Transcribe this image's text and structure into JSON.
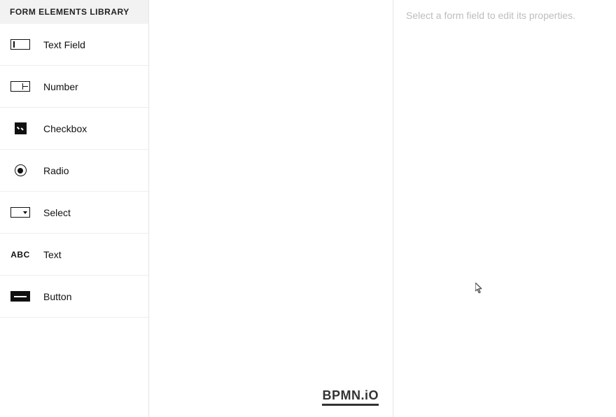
{
  "sidebar": {
    "header": "FORM ELEMENTS LIBRARY",
    "items": [
      {
        "label": "Text Field",
        "icon": "textfield-icon"
      },
      {
        "label": "Number",
        "icon": "number-icon"
      },
      {
        "label": "Checkbox",
        "icon": "checkbox-icon"
      },
      {
        "label": "Radio",
        "icon": "radio-icon"
      },
      {
        "label": "Select",
        "icon": "select-icon"
      },
      {
        "label": "Text",
        "icon": "text-icon",
        "icon_text": "ABC"
      },
      {
        "label": "Button",
        "icon": "button-icon"
      }
    ]
  },
  "canvas": {
    "brand": "BPMN.iO"
  },
  "properties": {
    "placeholder": "Select a form field to edit its properties."
  }
}
